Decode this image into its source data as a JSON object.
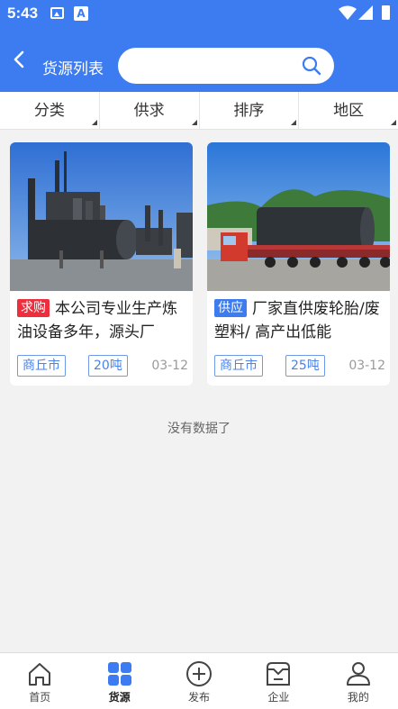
{
  "status_bar": {
    "time": "5:43",
    "a_icon_letter": "A"
  },
  "header": {
    "title": "货源列表",
    "search_placeholder": "",
    "search_value": ""
  },
  "filters": [
    {
      "label": "分类"
    },
    {
      "label": "供求"
    },
    {
      "label": "排序"
    },
    {
      "label": "地区"
    }
  ],
  "listings": [
    {
      "type": "求购",
      "title": "本公司专业生产炼油设备多年，源头厂",
      "city": "商丘市",
      "quantity": "20吨",
      "date": "03-12",
      "image_icon": "pyrolysis-plant-photo"
    },
    {
      "type": "供应",
      "title": "厂家直供废轮胎/废塑料/ 高产出低能",
      "city": "商丘市",
      "quantity": "25吨",
      "date": "03-12",
      "image_icon": "reactor-truck-photo"
    }
  ],
  "list_end_text": "没有数据了",
  "tabs": [
    {
      "label": "首页",
      "icon": "home-icon",
      "active": false
    },
    {
      "label": "货源",
      "icon": "grid-icon",
      "active": true
    },
    {
      "label": "发布",
      "icon": "plus-circle-icon",
      "active": false
    },
    {
      "label": "企业",
      "icon": "building-icon",
      "active": false
    },
    {
      "label": "我的",
      "icon": "user-icon",
      "active": false
    }
  ],
  "colors": {
    "brand_blue": "#3d7cf0",
    "buy_red": "#ee2d3d",
    "tag_outline": "#6f9ae8",
    "background": "#f2f2f2"
  }
}
